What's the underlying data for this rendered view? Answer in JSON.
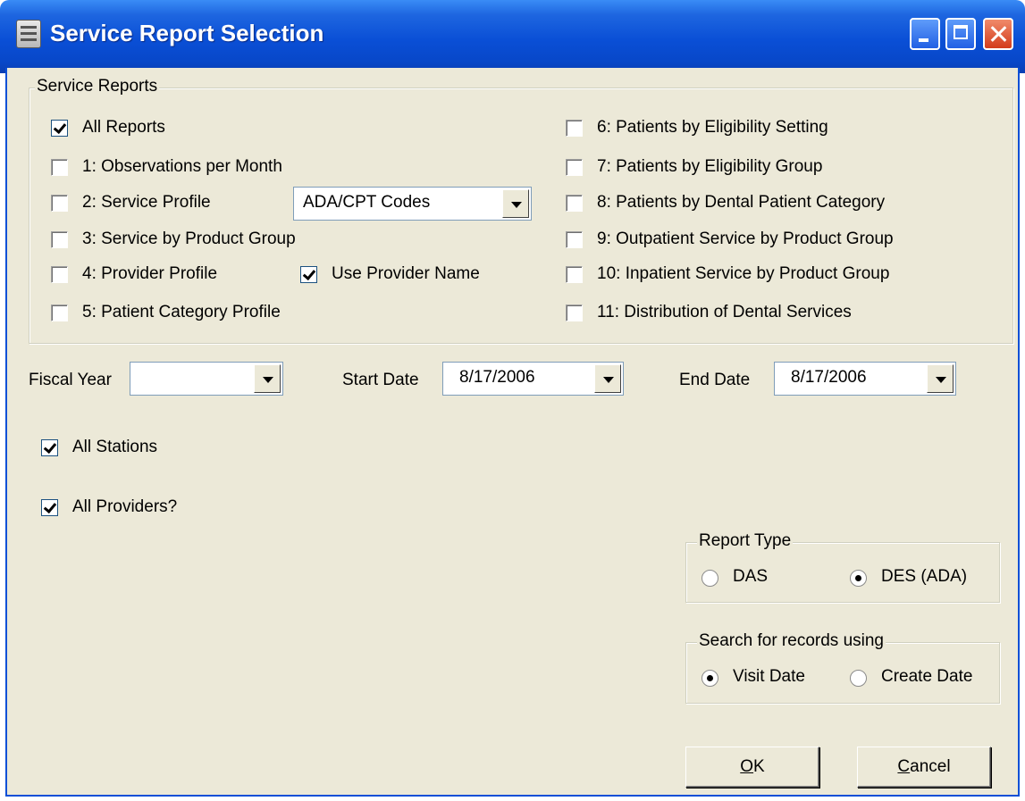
{
  "window": {
    "title": "Service Report Selection"
  },
  "service_reports": {
    "legend": "Service Reports",
    "all_reports": {
      "label": "All Reports",
      "checked": true
    },
    "left_items": [
      {
        "label": "1: Observations per Month",
        "checked": false
      },
      {
        "label": "2: Service Profile",
        "checked": false
      },
      {
        "label": "3: Service by Product Group",
        "checked": false
      },
      {
        "label": "4: Provider Profile",
        "checked": false
      },
      {
        "label": "5: Patient Category Profile",
        "checked": false
      }
    ],
    "service_profile_combo": {
      "value": "ADA/CPT Codes"
    },
    "use_provider_name": {
      "label": "Use Provider Name",
      "checked": true
    },
    "right_items": [
      {
        "label": "6: Patients by Eligibility Setting",
        "checked": false
      },
      {
        "label": "7: Patients by Eligibility Group",
        "checked": false
      },
      {
        "label": "8: Patients by Dental Patient Category",
        "checked": false
      },
      {
        "label": "9: Outpatient Service by Product Group",
        "checked": false
      },
      {
        "label": "10: Inpatient Service by Product Group",
        "checked": false
      },
      {
        "label": "11: Distribution of Dental Services",
        "checked": false
      }
    ]
  },
  "dates": {
    "fiscal_year_label": "Fiscal Year",
    "fiscal_year_value": "",
    "start_date_label": "Start Date",
    "start_date_value": "8/17/2006",
    "end_date_label": "End Date",
    "end_date_value": "8/17/2006"
  },
  "filters": {
    "all_stations": {
      "label": "All Stations",
      "checked": true
    },
    "all_providers": {
      "label": "All Providers?",
      "checked": true
    }
  },
  "report_type": {
    "legend": "Report Type",
    "options": [
      {
        "label": "DAS",
        "selected": false
      },
      {
        "label": "DES (ADA)",
        "selected": true
      }
    ]
  },
  "search_using": {
    "legend": "Search for records using",
    "options": [
      {
        "label": "Visit Date",
        "selected": true
      },
      {
        "label": "Create Date",
        "selected": false
      }
    ]
  },
  "buttons": {
    "ok_mnemonic": "O",
    "ok_rest": "K",
    "cancel_mnemonic": "C",
    "cancel_rest": "ancel"
  }
}
